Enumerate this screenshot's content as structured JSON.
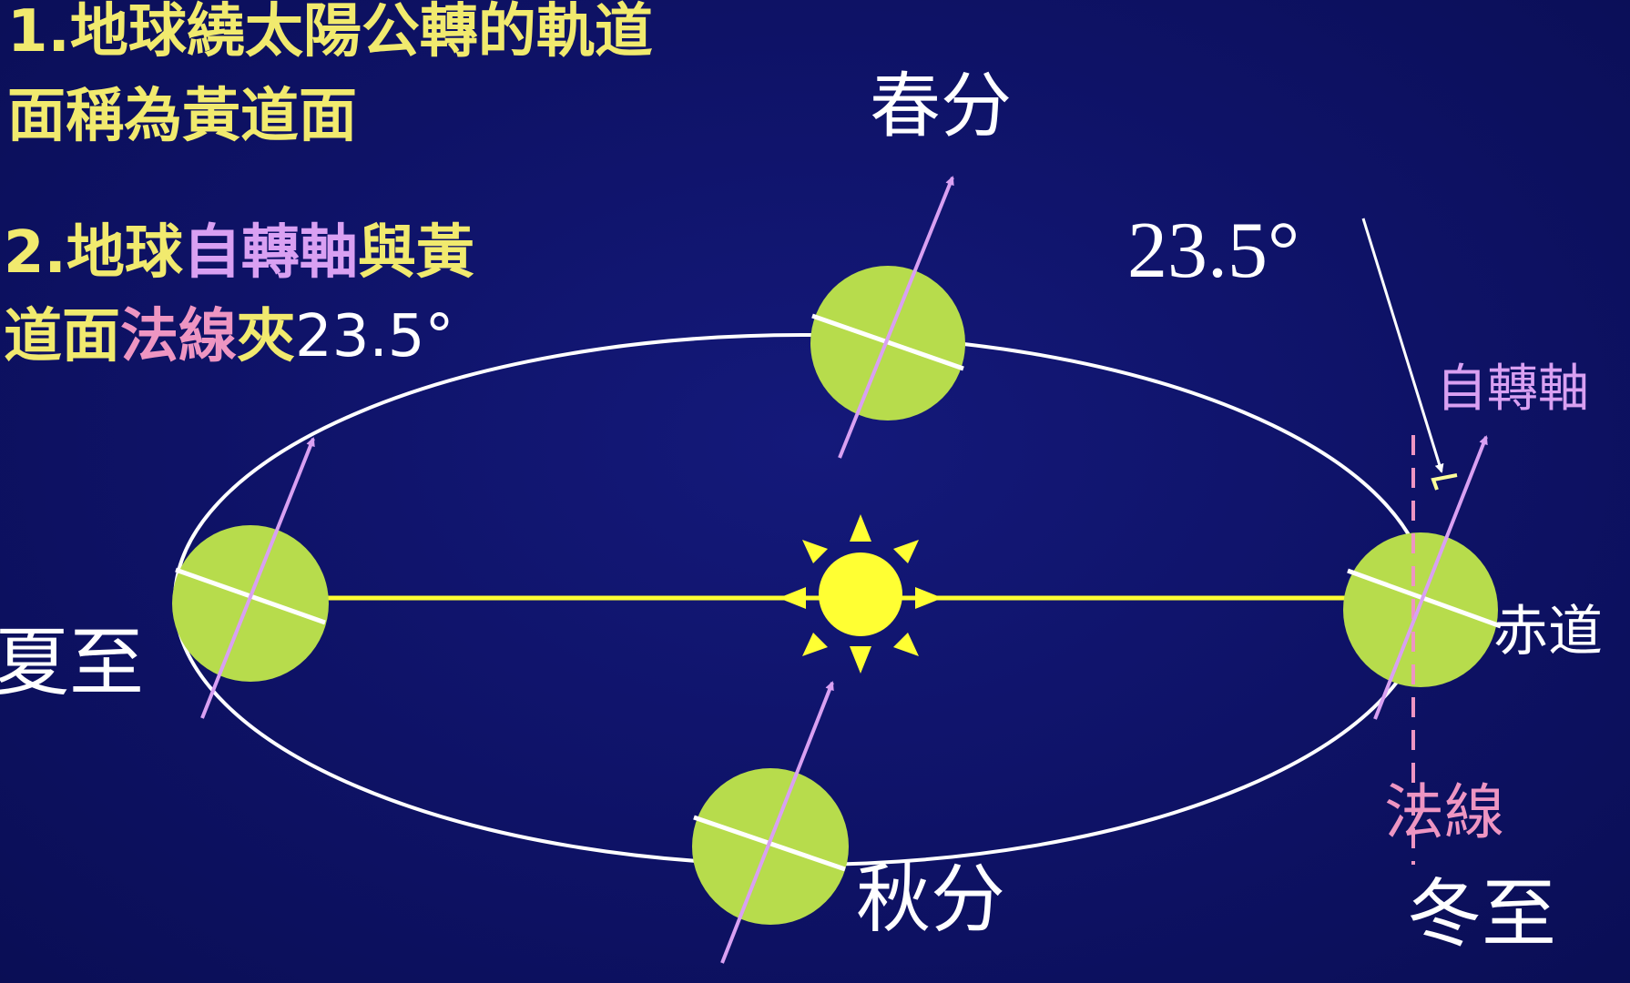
{
  "point1": {
    "line1": "1.地球繞太陽公轉的軌道",
    "line2": "面稱為黃道面"
  },
  "point2": {
    "line1_a": "2.地球",
    "line1_b": "自轉軸",
    "line1_c": "與黃",
    "line2_a": "道面",
    "line2_b": "法線",
    "line2_c": "夾",
    "line2_d": "23.5°"
  },
  "labels": {
    "spring_equinox": "春分",
    "autumn_equinox": "秋分",
    "summer_solstice": "夏至",
    "winter_solstice": "冬至",
    "angle": "23.5°",
    "rotation_axis": "自轉軸",
    "equator": "赤道",
    "normal_line": "法線"
  },
  "colors": {
    "background": "#0e1266",
    "earth": "#b7dc4c",
    "sun": "#ffff33",
    "orbit": "#ffffff",
    "axis": "#d9a0f2",
    "normal": "#ee95c2",
    "title_yellow": "#f1ea6e"
  }
}
